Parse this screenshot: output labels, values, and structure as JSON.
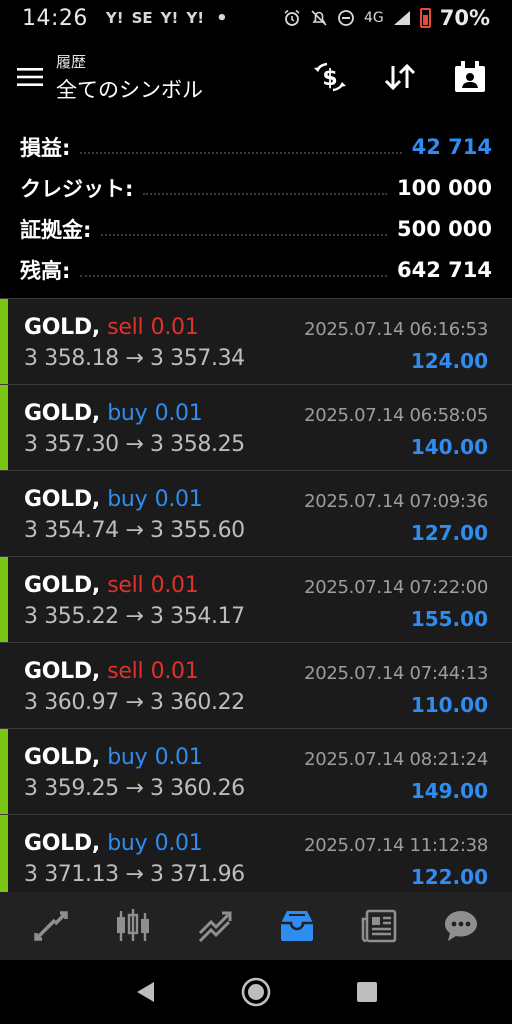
{
  "status_bar": {
    "time": "14:26",
    "left_icons": [
      "Y!",
      "SE",
      "Y!",
      "Y!"
    ],
    "network": "4G",
    "battery_percent": "70%"
  },
  "toolbar": {
    "subtitle": "履歴",
    "title": "全てのシンボル",
    "actions": [
      "dollar-exchange-icon",
      "sort-icon",
      "calendar-icon"
    ]
  },
  "summary": [
    {
      "label": "損益:",
      "value": "42 714",
      "highlight": true
    },
    {
      "label": "クレジット:",
      "value": "100 000",
      "highlight": false
    },
    {
      "label": "証拠金:",
      "value": "500 000",
      "highlight": false
    },
    {
      "label": "残高:",
      "value": "642 714",
      "highlight": false
    }
  ],
  "deals": [
    {
      "symbol": "GOLD,",
      "side": "sell",
      "volume": "0.01",
      "prices": "3 358.18 → 3 357.34",
      "datetime": "2025.07.14 06:16:53",
      "profit": "124.00",
      "marker": true
    },
    {
      "symbol": "GOLD,",
      "side": "buy",
      "volume": "0.01",
      "prices": "3 357.30 → 3 358.25",
      "datetime": "2025.07.14 06:58:05",
      "profit": "140.00",
      "marker": true
    },
    {
      "symbol": "GOLD,",
      "side": "buy",
      "volume": "0.01",
      "prices": "3 354.74 → 3 355.60",
      "datetime": "2025.07.14 07:09:36",
      "profit": "127.00",
      "marker": false
    },
    {
      "symbol": "GOLD,",
      "side": "sell",
      "volume": "0.01",
      "prices": "3 355.22 → 3 354.17",
      "datetime": "2025.07.14 07:22:00",
      "profit": "155.00",
      "marker": true
    },
    {
      "symbol": "GOLD,",
      "side": "sell",
      "volume": "0.01",
      "prices": "3 360.97 → 3 360.22",
      "datetime": "2025.07.14 07:44:13",
      "profit": "110.00",
      "marker": false
    },
    {
      "symbol": "GOLD,",
      "side": "buy",
      "volume": "0.01",
      "prices": "3 359.25 → 3 360.26",
      "datetime": "2025.07.14 08:21:24",
      "profit": "149.00",
      "marker": true
    },
    {
      "symbol": "GOLD,",
      "side": "buy",
      "volume": "0.01",
      "prices": "3 371.13 → 3 371.96",
      "datetime": "2025.07.14 11:12:38",
      "profit": "122.00",
      "marker": true
    }
  ],
  "bottom_nav": [
    {
      "icon": "quotes-icon",
      "active": false
    },
    {
      "icon": "chart-icon",
      "active": false
    },
    {
      "icon": "trade-icon",
      "active": false
    },
    {
      "icon": "history-icon",
      "active": true
    },
    {
      "icon": "news-icon",
      "active": false
    },
    {
      "icon": "messages-icon",
      "active": false
    }
  ],
  "colors": {
    "accent_blue": "#2f8cf0",
    "sell_red": "#e0312b",
    "marker_green": "#7cc613",
    "background": "#1b1b1b"
  }
}
